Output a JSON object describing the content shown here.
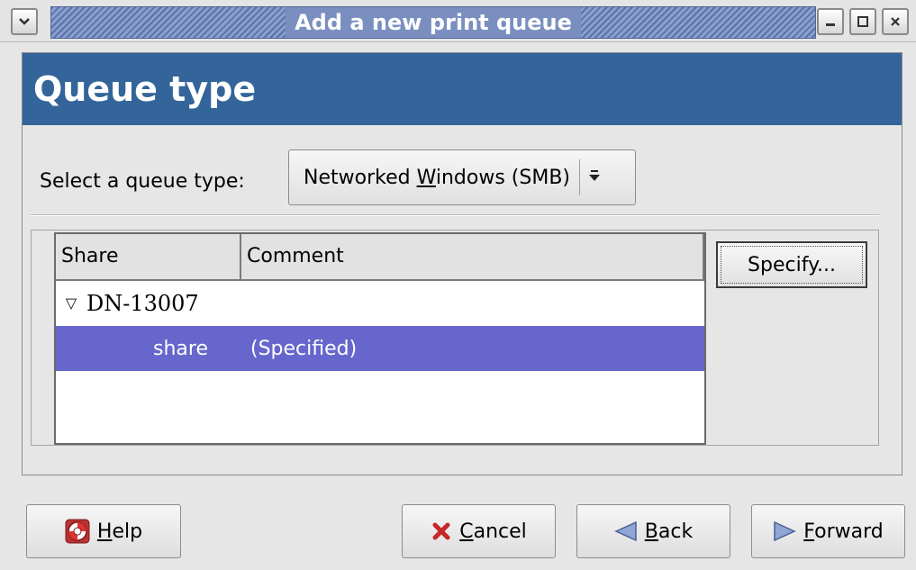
{
  "window": {
    "title": "Add a new print queue"
  },
  "banner": {
    "title": "Queue type"
  },
  "queue_type": {
    "label": "Select a queue type:",
    "selected_before": "Networked ",
    "selected_mnemonic": "W",
    "selected_after": "indows (SMB)"
  },
  "share_list": {
    "columns": [
      "Share",
      "Comment"
    ],
    "host": "DN-13007",
    "rows": [
      {
        "share": "share",
        "comment": "(Specified)"
      }
    ]
  },
  "specify_button": {
    "label": "Specify..."
  },
  "buttons": {
    "help": {
      "mnemonic": "H",
      "rest": "elp"
    },
    "cancel": {
      "mnemonic": "C",
      "rest": "ancel"
    },
    "back": {
      "mnemonic": "B",
      "rest": "ack"
    },
    "forward": {
      "mnemonic": "F",
      "rest": "orward"
    }
  },
  "colors": {
    "banner": "#33659a",
    "selection": "#6666cc",
    "title_stripe": "#5a73ad"
  }
}
